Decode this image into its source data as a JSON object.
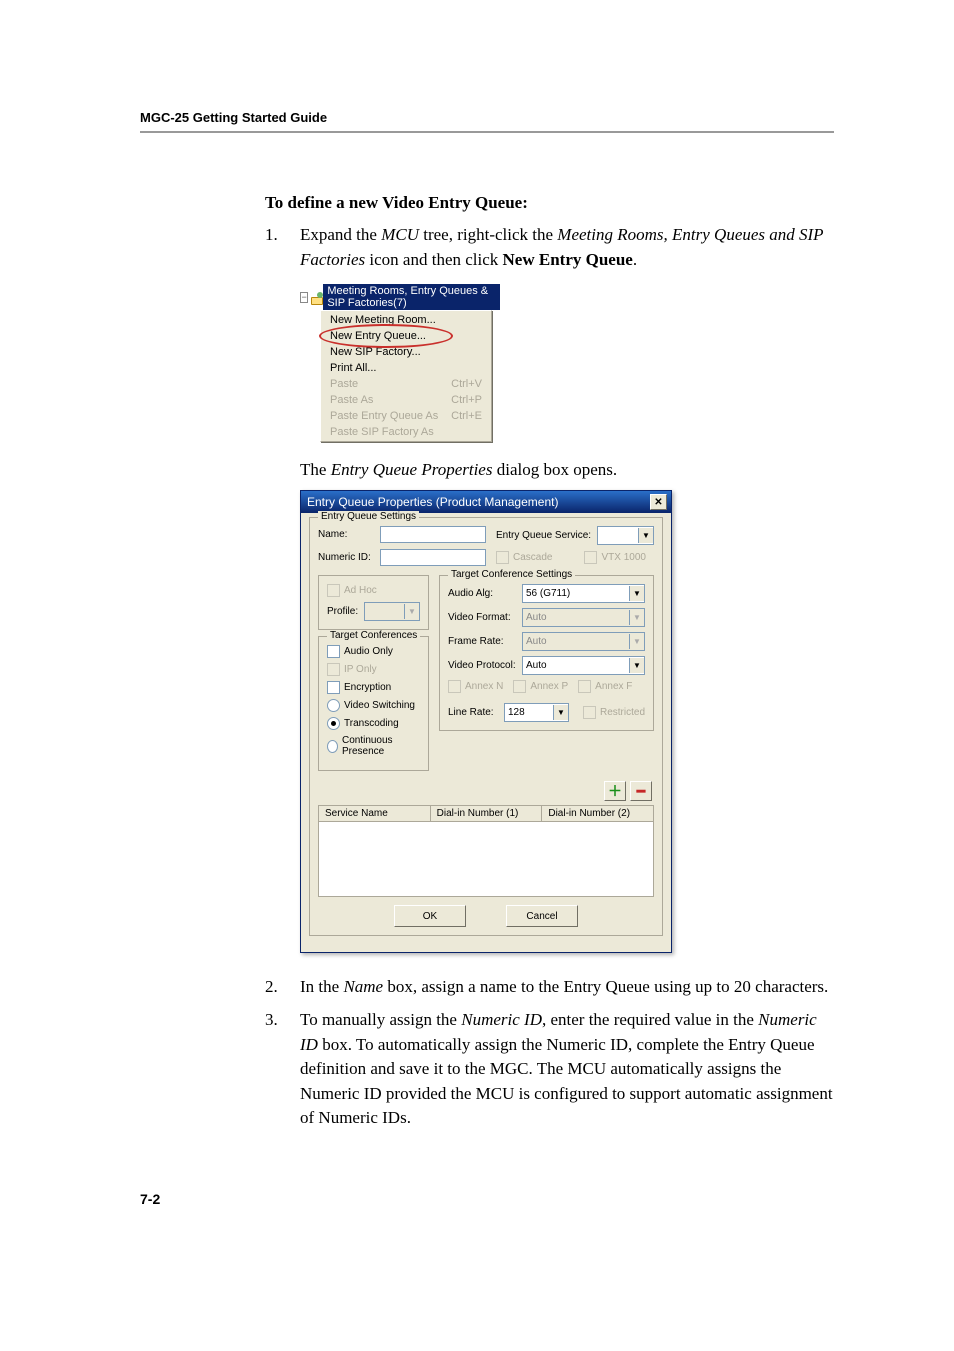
{
  "header": {
    "title": "MGC-25 Getting Started Guide"
  },
  "section": {
    "heading": "To define a new Video Entry Queue:"
  },
  "step1": {
    "num": "1.",
    "t1": "Expand the ",
    "mcu": "MCU",
    "t2": " tree, right-click the ",
    "node": "Meeting Rooms, Entry Queues and SIP Factories",
    "t3": " icon and then click ",
    "cmd": "New Entry Queue",
    "t4": "."
  },
  "ctxmenu": {
    "tree_label": "Meeting Rooms, Entry Queues & SIP Factories(7)",
    "items": {
      "new_meeting_room": "New Meeting Room...",
      "new_entry_queue": "New Entry Queue...",
      "new_sip_factory": "New SIP Factory...",
      "print_all": "Print All...",
      "paste": "Paste",
      "paste_sc": "Ctrl+V",
      "paste_as": "Paste As",
      "paste_as_sc": "Ctrl+P",
      "paste_eq_as": "Paste Entry Queue As",
      "paste_eq_as_sc": "Ctrl+E",
      "paste_sip_as": "Paste SIP Factory As"
    }
  },
  "caption1": {
    "t1": "The ",
    "em": "Entry Queue Properties",
    "t2": " dialog box opens."
  },
  "dialog": {
    "title": "Entry Queue Properties (Product Management)",
    "group_eq_settings": "Entry Queue Settings",
    "name_label": "Name:",
    "name_value": "",
    "numeric_id_label": "Numeric ID:",
    "numeric_id_value": "",
    "eq_service_label": "Entry Queue Service:",
    "eq_service_value": "",
    "cascade_label": "Cascade",
    "vtx_label": "VTX 1000",
    "adhoc_label": "Ad Hoc",
    "profile_label": "Profile:",
    "profile_value": "",
    "group_target_conf": "Target Conferences",
    "audio_only_label": "Audio Only",
    "ip_only_label": "IP Only",
    "encryption_label": "Encryption",
    "video_switching_label": "Video Switching",
    "transcoding_label": "Transcoding",
    "continuous_presence_label": "Continuous Presence",
    "group_target_settings": "Target Conference Settings",
    "audio_alg_label": "Audio Alg:",
    "audio_alg_value": "56 (G711)",
    "video_format_label": "Video Format:",
    "video_format_value": "Auto",
    "frame_rate_label": "Frame Rate:",
    "frame_rate_value": "Auto",
    "video_protocol_label": "Video Protocol:",
    "video_protocol_value": "Auto",
    "annex_n_label": "Annex N",
    "annex_p_label": "Annex P",
    "annex_f_label": "Annex F",
    "line_rate_label": "Line Rate:",
    "line_rate_value": "128",
    "restricted_label": "Restricted",
    "tbl_h1": "Service Name",
    "tbl_h2": "Dial-in Number (1)",
    "tbl_h3": "Dial-in Number (2)",
    "ok": "OK",
    "cancel": "Cancel"
  },
  "step2": {
    "num": "2.",
    "t1": "In the ",
    "name": "Name",
    "t2": " box, assign a name to the Entry Queue using up to 20 characters."
  },
  "step3": {
    "num": "3.",
    "t1": "To manually assign the ",
    "nid": "Numeric ID",
    "t2": ", enter the required value in the ",
    "nid2": "Numeric ID",
    "t3": " box. To automatically assign the Numeric ID, complete the Entry Queue definition and save it to the MGC. The MCU automatically assigns the Numeric ID provided the MCU is configured to support automatic assignment of Numeric IDs."
  },
  "page_number": "7-2"
}
